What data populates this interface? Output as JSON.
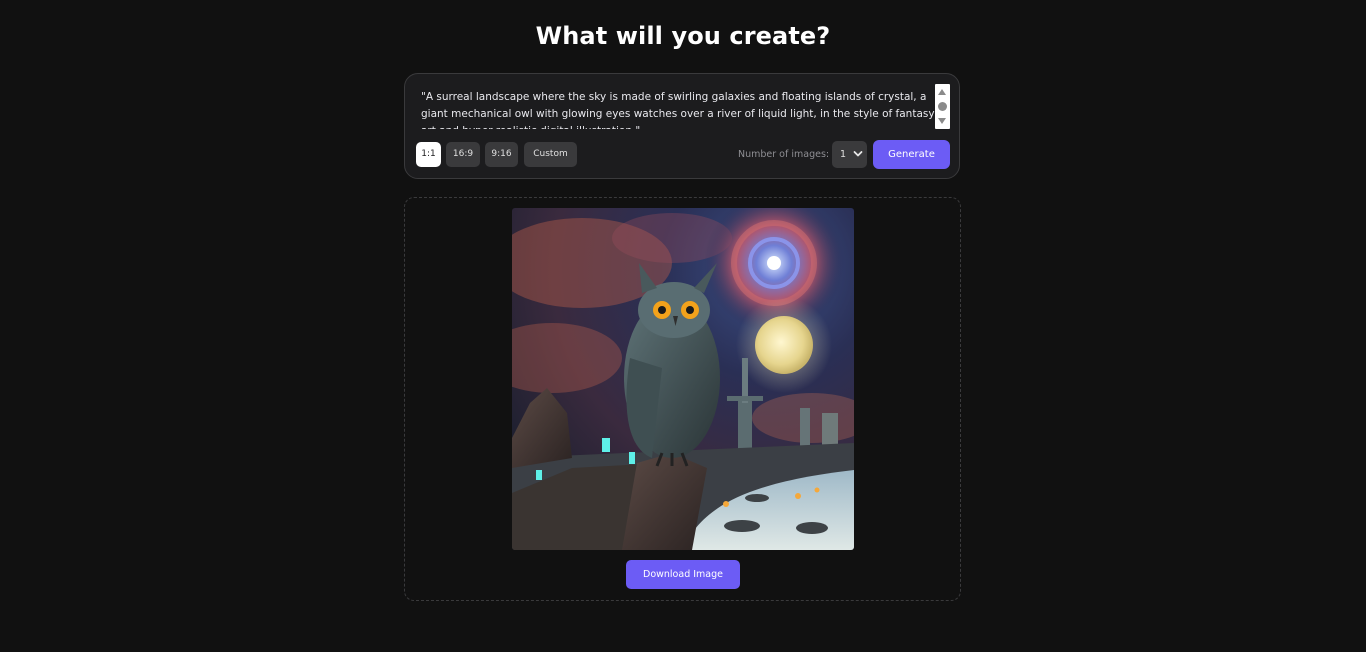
{
  "heading": "What will you create?",
  "prompt": {
    "text": "\"A surreal landscape where the sky is made of swirling galaxies and floating islands of crystal, a giant mechanical owl with glowing eyes watches over a river of liquid light, in the style of fantasy art and hyper-realistic digital illustration.\""
  },
  "aspect_ratios": [
    {
      "label": "1:1",
      "active": true
    },
    {
      "label": "16:9",
      "active": false
    },
    {
      "label": "9:16",
      "active": false
    },
    {
      "label": "Custom",
      "active": false
    }
  ],
  "num_images": {
    "label": "Number of images:",
    "value": "1"
  },
  "generate_label": "Generate",
  "result": {
    "image_subject": "mechanical owl perched on rock under swirling galaxy sky with full moon and glowing river",
    "download_label": "Download Image"
  },
  "colors": {
    "background": "#111111",
    "card": "#1c1c1e",
    "accent": "#6c5cf5",
    "button_muted": "#3a3a3c"
  }
}
